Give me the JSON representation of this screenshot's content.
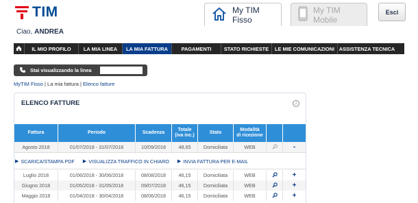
{
  "header": {
    "logo_text": "TIM",
    "tab_fisso": "My TIM Fisso",
    "tab_mobile": "My TIM Mobile",
    "logout": "Esci",
    "greeting_prefix": "Ciao,",
    "user_name": "ANDREA"
  },
  "nav": {
    "items": [
      {
        "label": "IL MIO PROFILO"
      },
      {
        "label": "LA MIA LINEA"
      },
      {
        "label": "LA MIA FATTURA"
      },
      {
        "label": "PAGAMENTI"
      },
      {
        "label": "STATO RICHIESTE"
      },
      {
        "label": "LE MIE COMUNICAZIONI"
      },
      {
        "label": "ASSISTENZA TECNICA"
      }
    ]
  },
  "line_bar": {
    "label": "Stai visualizzando la linea"
  },
  "breadcrumb": {
    "home": "MyTIM Fisso",
    "sep": " | ",
    "section": "La mia fattura",
    "page": "Elenco fatture"
  },
  "panel": {
    "title": "ELENCO FATTURE",
    "columns": [
      "Fattura",
      "Periodo",
      "Scadenza",
      "Totale\n(iva inc.)",
      "Stato",
      "Modalità\ndi ricezione",
      "",
      ""
    ],
    "rows": [
      {
        "fattura": "Agosto 2018",
        "periodo": "01/07/2018 - 31/07/2018",
        "scadenza": "10/09/2018",
        "totale": "48,65",
        "stato": "Domiciliata",
        "modalita": "WEB",
        "toggle": "-"
      },
      {
        "fattura": "Luglio 2018",
        "periodo": "01/06/2018 - 30/06/2018",
        "scadenza": "08/08/2018",
        "totale": "46,15",
        "stato": "Domiciliata",
        "modalita": "WEB",
        "toggle": "+"
      },
      {
        "fattura": "Giugno 2018",
        "periodo": "01/05/2018 - 31/05/2018",
        "scadenza": "09/07/2018",
        "totale": "46,15",
        "stato": "Domiciliata",
        "modalita": "WEB",
        "toggle": "+"
      },
      {
        "fattura": "Maggio 2018",
        "periodo": "01/04/2018 - 30/04/2018",
        "scadenza": "08/06/2018",
        "totale": "46,15",
        "stato": "Domiciliata",
        "modalita": "WEB",
        "toggle": "+"
      }
    ],
    "actions": {
      "download": "SCARICA/STAMPA PDF",
      "traffic": "VISUALIZZA TRAFFICO IN CHIARO",
      "email": "INVIA FATTURA PER E-MAIL"
    }
  },
  "colors": {
    "brand_blue": "#004b93",
    "brand_red": "#e2001a",
    "table_header": "#2f8ed8",
    "nav_active": "#0a3e8a"
  },
  "icons": [
    "home-icon",
    "phone-icon",
    "mobile-phone-icon",
    "info-icon",
    "search-icon",
    "arrow-right-icon"
  ]
}
